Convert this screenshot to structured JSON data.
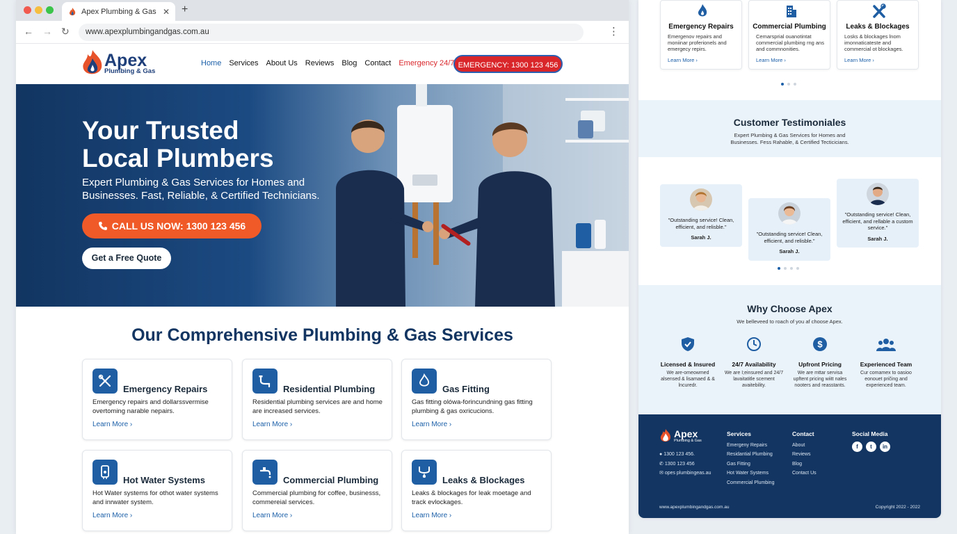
{
  "browser": {
    "tab_title": "Apex Plumbing & Gas",
    "tab_close": "✕",
    "new_tab": "+",
    "url": "www.apexplumbingandgas.com.au",
    "back": "←",
    "forward": "→",
    "reload": "↻",
    "menu": "⋮"
  },
  "header": {
    "logo_name": "Apex",
    "logo_sub": "Plumbing & Gas",
    "nav": [
      "Home",
      "Services",
      "About Us",
      "Reviews",
      "Blog",
      "Contact",
      "Emergency 24/7"
    ],
    "emergency_button": "EMERGENCY: 1300 123 456"
  },
  "hero": {
    "title_line1": "Your Trusted",
    "title_line2": "Local Plumbers",
    "subtitle": "Expert Plumbing & Gas Services for Homes and Businesses. Fast, Reliable, & Certified Technicians.",
    "call_button": "CALL US NOW: 1300 123 456",
    "quote_button": "Get a Free Quote"
  },
  "services": {
    "title": "Our Comprehensive Plumbing & Gas Services",
    "learn_more": "Learn More ›",
    "cards": [
      {
        "title": "Emergency Repairs",
        "desc": "Emergency repairs and dollarssvermise overtoming narable nepairs.",
        "icon": "tools-icon"
      },
      {
        "title": "Residential Plumbing",
        "desc": "Residential plumbing services are and home are increased services.",
        "icon": "pipe-icon"
      },
      {
        "title": "Gas Fitting",
        "desc": "Gas fitting olówa-forincundning gas fitting plumbing & gas oxricucions.",
        "icon": "flame-icon"
      },
      {
        "title": "Hot Water Systems",
        "desc": "Hot Water systems for othot water systems and inrwater system.",
        "icon": "water-heater-icon"
      },
      {
        "title": "Commercial Plumbing",
        "desc": "Commercial plumbing for coffee, businesss, commereial services.",
        "icon": "faucet-icon"
      },
      {
        "title": "Leaks & Blockages",
        "desc": "Leaks & blockages for leak moetage and track evlockages.",
        "icon": "leak-icon"
      }
    ]
  },
  "right_panel": {
    "mini_learn_more": "Learn More ›",
    "mini_cards": [
      {
        "title": "Emergency Repairs",
        "desc": "Emergenov repairs and moniinar proferionels and emergecy repirs.",
        "icon": "flame-icon"
      },
      {
        "title": "Commercial Plumbing",
        "desc": "Cemarsprial ouanotintat commercial plumbing rng ans and commnonities.",
        "icon": "building-icon"
      },
      {
        "title": "Leaks & Blockages",
        "desc": "Losks & blockages lnom imonnaticateste and commercial ot blockages.",
        "icon": "wrench-icon"
      }
    ],
    "testimonials": {
      "title": "Customer Testimoniales",
      "subtitle": "Expert Plumbing & Gas Services for Homes and Businesses. Fess Rahable, & Certified Tecticicians.",
      "items": [
        {
          "quote": "\"Outstanding service! Clean, efficient, and relisble.\"",
          "name": "Sarah J."
        },
        {
          "quote": "\"Outstanding service! Clean, efficient, and relisble.\"",
          "name": "Sarah J."
        },
        {
          "quote": "\"Outstanding service! Clean, efficient, and rellable a custom service.\"",
          "name": "Sarah J."
        }
      ]
    },
    "why": {
      "title": "Why Choose Apex",
      "subtitle": "We belleveed to roach of you af choose Apex.",
      "features": [
        {
          "title": "Licensed & Insured",
          "desc": "We are-omeowmed alsensed & lisamaed & & lncuredr.",
          "icon": "shield-icon"
        },
        {
          "title": "24/7 Availability",
          "desc": "We are I;einsured and 24/7 lavaitatitle scement avaitebility.",
          "icon": "clock-icon"
        },
        {
          "title": "Upfront Pricing",
          "desc": "We are mttar servisa upftent pricing wiitt nales nooters and reasstants.",
          "icon": "dollar-icon"
        },
        {
          "title": "Experienced Team",
          "desc": "Cur comamex to oasioo eonouet pričing and experienced team.",
          "icon": "team-icon"
        }
      ]
    },
    "footer": {
      "logo_name": "Apex",
      "logo_sub": "Plumbing & Gas",
      "phone1": "1300 123 456.",
      "phone2": "1300 123 456",
      "email": "opes plumbingeas.au",
      "services_head": "Services",
      "services": [
        "Emergeny Repairs",
        "Residantial Plumbing",
        "Gas Fitting",
        "Hot Water Systems",
        "Commercial Plumbing"
      ],
      "contact_head": "Contact",
      "contact": [
        "About",
        "Reviews",
        "Blog",
        "Contact Us"
      ],
      "social_head": "Social Media",
      "social": [
        "f",
        "t",
        "in"
      ],
      "site_url": "www.apexplumbingandgas.com.au",
      "copyright": "Copyright 2022 - 2022"
    }
  },
  "colors": {
    "brand_navy": "#123561",
    "brand_blue": "#1b5fa8",
    "emergency_red": "#d9262b",
    "cta_orange": "#ef5a28"
  }
}
